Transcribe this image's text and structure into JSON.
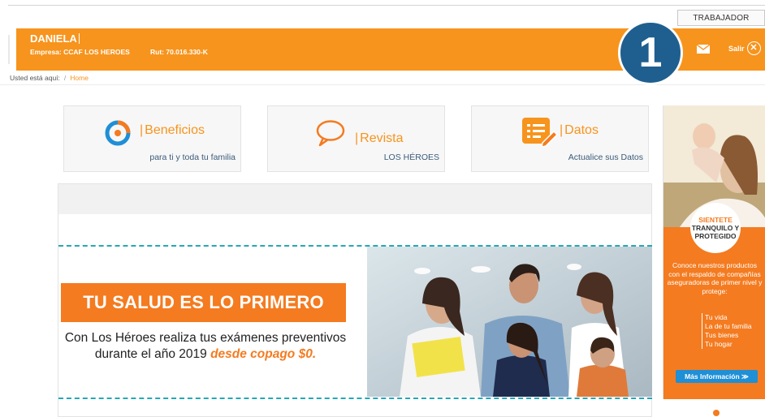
{
  "top": {
    "role_button": "TRABAJADOR"
  },
  "header": {
    "user_name": "DANIELA",
    "empresa": "Empresa: CCAF LOS HEROES",
    "rut": "Rut: 70.016.330-K",
    "logout_label": "Salir",
    "logout_icon": "close-circle-icon",
    "mail_icon": "mail-icon",
    "step_number": "1"
  },
  "breadcrumb": {
    "prefix": "Usted está aquí:",
    "separator": "/",
    "home": "Home"
  },
  "cards": [
    {
      "title": "Beneficios",
      "subtitle": "para ti y toda tu familia",
      "icon": "benefits-ring-icon"
    },
    {
      "title": "Revista",
      "subtitle": "LOS HÉROES",
      "icon": "speech-bubble-icon"
    },
    {
      "title": "Datos",
      "subtitle": "Actualice sus Datos",
      "icon": "document-edit-icon"
    }
  ],
  "banner": {
    "headline": "TU SALUD ES LO PRIMERO",
    "body_line1": "Con Los Héroes realiza tus exámenes preventivos",
    "body_line2": "durante el año 2019",
    "body_highlight": "desde copago $0."
  },
  "side_ad": {
    "circle_line1": "SIENTETE",
    "circle_line2": "TRANQUILO Y",
    "circle_line3": "PROTEGIDO",
    "desc": "Conoce nuestros productos con el respaldo de compañías aseguradoras de primer nivel y protege:",
    "items": [
      "Tu vida",
      "La de tu familia",
      "Tus bienes",
      "Tu hogar"
    ],
    "button": "Más Información  ≫"
  },
  "colors": {
    "brand_orange": "#f7941d",
    "banner_orange": "#f47b20",
    "badge_blue": "#1f5f8f",
    "accent_teal": "#27a7b5",
    "link_blue": "#3b5b78"
  }
}
